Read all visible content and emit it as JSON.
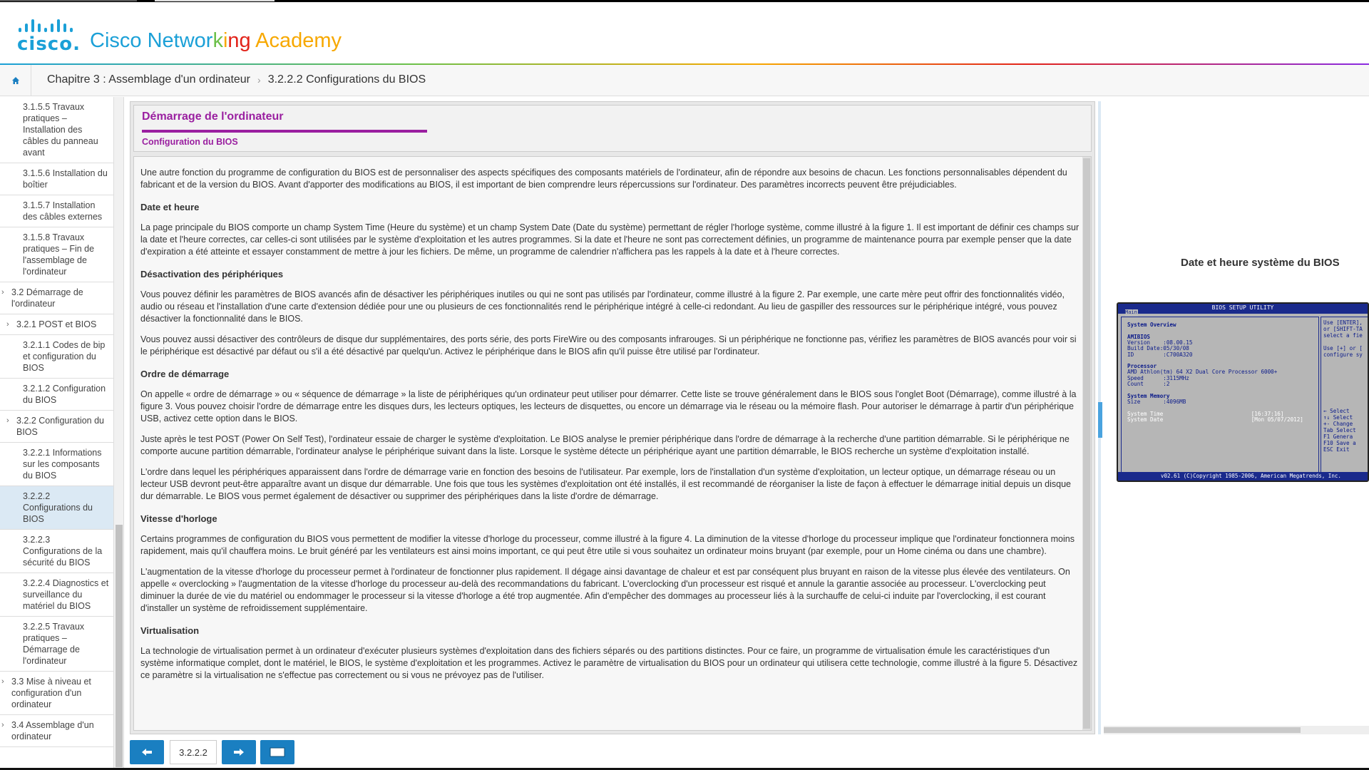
{
  "header": {
    "logo_word": "cisco",
    "brand_parts": [
      {
        "text": "Cisco ",
        "color": "#1ba0d7"
      },
      {
        "text": "Networ",
        "color": "#1ba0d7"
      },
      {
        "text": "k",
        "color": "#6cc04a"
      },
      {
        "text": "i",
        "color": "#f7a800"
      },
      {
        "text": "ng ",
        "color": "#e2231a"
      },
      {
        "text": "Academy",
        "color": "#f7a800"
      }
    ]
  },
  "breadcrumb": {
    "chapter": "Chapitre 3 : Assemblage d'un ordinateur",
    "section": "3.2.2.2 Configurations du BIOS"
  },
  "sidebar": [
    {
      "label": "3.1.5.5 Travaux pratiques – Installation des câbles du panneau avant",
      "level": 3
    },
    {
      "label": "3.1.5.6 Installation du boîtier",
      "level": 3
    },
    {
      "label": "3.1.5.7 Installation des câbles externes",
      "level": 3
    },
    {
      "label": "3.1.5.8 Travaux pratiques – Fin de l'assemblage de l'ordinateur",
      "level": 3
    },
    {
      "label": "3.2 Démarrage de l'ordinateur",
      "level": 1
    },
    {
      "label": "3.2.1 POST et BIOS",
      "level": 2
    },
    {
      "label": "3.2.1.1 Codes de bip et configuration du BIOS",
      "level": 3
    },
    {
      "label": "3.2.1.2 Configuration du BIOS",
      "level": 3
    },
    {
      "label": "3.2.2 Configuration du BIOS",
      "level": 2
    },
    {
      "label": "3.2.2.1 Informations sur les composants du BIOS",
      "level": 3
    },
    {
      "label": "3.2.2.2 Configurations du BIOS",
      "level": 3,
      "active": true
    },
    {
      "label": "3.2.2.3 Configurations de la sécurité du BIOS",
      "level": 3
    },
    {
      "label": "3.2.2.4 Diagnostics et surveillance du matériel du BIOS",
      "level": 3
    },
    {
      "label": "3.2.2.5 Travaux pratiques – Démarrage de l'ordinateur",
      "level": 3
    },
    {
      "label": "3.3 Mise à niveau et configuration d'un ordinateur",
      "level": 1
    },
    {
      "label": "3.4 Assemblage d'un ordinateur",
      "level": 1
    }
  ],
  "content": {
    "title": "Démarrage de l'ordinateur",
    "subtitle": "Configuration du BIOS",
    "blocks": [
      {
        "type": "p",
        "text": "Une autre fonction du programme de configuration du BIOS est de personnaliser des aspects spécifiques des composants matériels de l'ordinateur, afin de répondre aux besoins de chacun. Les fonctions personnalisables dépendent du fabricant et de la version du BIOS. Avant d'apporter des modifications au BIOS, il est important de bien comprendre leurs répercussions sur l'ordinateur. Des paramètres incorrects peuvent être préjudiciables."
      },
      {
        "type": "h",
        "text": "Date et heure"
      },
      {
        "type": "p",
        "text": "La page principale du BIOS comporte un champ System Time (Heure du système) et un champ System Date (Date du système) permettant de régler l'horloge système, comme illustré à la figure 1. Il est important de définir ces champs sur la date et l'heure correctes, car celles-ci sont utilisées par le système d'exploitation et les autres programmes. Si la date et l'heure ne sont pas correctement définies, un programme de maintenance pourra par exemple penser que la date d'expiration a été atteinte et essayer constamment de mettre à jour les fichiers. De même, un programme de calendrier n'affichera pas les rappels à la date et à l'heure correctes."
      },
      {
        "type": "h",
        "text": "Désactivation des périphériques"
      },
      {
        "type": "p",
        "text": "Vous pouvez définir les paramètres de BIOS avancés afin de désactiver les périphériques inutiles ou qui ne sont pas utilisés par l'ordinateur, comme illustré à la figure 2. Par exemple, une carte mère peut offrir des fonctionnalités vidéo, audio ou réseau et l'installation d'une carte d'extension dédiée pour une ou plusieurs de ces fonctionnalités rend le périphérique intégré à celle-ci redondant. Au lieu de gaspiller des ressources sur le périphérique intégré, vous pouvez désactiver la fonctionnalité dans le BIOS."
      },
      {
        "type": "p",
        "text": "Vous pouvez aussi désactiver des contrôleurs de disque dur supplémentaires, des ports série, des ports FireWire ou des composants infrarouges. Si un périphérique ne fonctionne pas, vérifiez les paramètres de BIOS avancés pour voir si le périphérique est désactivé par défaut ou s'il a été désactivé par quelqu'un. Activez le périphérique dans le BIOS afin qu'il puisse être utilisé par l'ordinateur."
      },
      {
        "type": "h",
        "text": "Ordre de démarrage"
      },
      {
        "type": "p",
        "text": "On appelle « ordre de démarrage » ou « séquence de démarrage » la liste de périphériques qu'un ordinateur peut utiliser pour démarrer. Cette liste se trouve généralement dans le BIOS sous l'onglet Boot (Démarrage), comme illustré à la figure 3. Vous pouvez choisir l'ordre de démarrage entre les disques durs, les lecteurs optiques, les lecteurs de disquettes, ou encore un démarrage via le réseau ou la mémoire flash. Pour autoriser le démarrage à partir d'un périphérique USB, activez cette option dans le BIOS."
      },
      {
        "type": "p",
        "text": "Juste après le test POST (Power On Self Test), l'ordinateur essaie de charger le système d'exploitation. Le BIOS analyse le premier périphérique dans l'ordre de démarrage à la recherche d'une partition démarrable. Si le périphérique ne comporte aucune partition démarrable, l'ordinateur analyse le périphérique suivant dans la liste. Lorsque le système détecte un périphérique ayant une partition démarrable, le BIOS recherche un système d'exploitation installé."
      },
      {
        "type": "p",
        "text": "L'ordre dans lequel les périphériques apparaissent dans l'ordre de démarrage varie en fonction des besoins de l'utilisateur. Par exemple, lors de l'installation d'un système d'exploitation, un lecteur optique, un démarrage réseau ou un lecteur USB devront peut-être apparaître avant un disque dur démarrable. Une fois que tous les systèmes d'exploitation ont été installés, il est recommandé de réorganiser la liste de façon à effectuer le démarrage initial depuis un disque dur démarrable. Le BIOS vous permet également de désactiver ou supprimer des périphériques dans la liste d'ordre de démarrage."
      },
      {
        "type": "h",
        "text": "Vitesse d'horloge"
      },
      {
        "type": "p",
        "text": "Certains programmes de configuration du BIOS vous permettent de modifier la vitesse d'horloge du processeur, comme illustré à la figure 4. La diminution de la vitesse d'horloge du processeur implique que l'ordinateur fonctionnera moins rapidement, mais qu'il chauffera moins. Le bruit généré par les ventilateurs est ainsi moins important, ce qui peut être utile si vous souhaitez un ordinateur moins bruyant (par exemple, pour un Home cinéma ou dans une chambre)."
      },
      {
        "type": "p",
        "text": "L'augmentation de la vitesse d'horloge du processeur permet à l'ordinateur de fonctionner plus rapidement. Il dégage ainsi davantage de chaleur et est par conséquent plus bruyant en raison de la vitesse plus élevée des ventilateurs. On appelle « overclocking » l'augmentation de la vitesse d'horloge du processeur au-delà des recommandations du fabricant. L'overclocking d'un processeur est risqué et annule la garantie associée au processeur. L'overclocking peut diminuer la durée de vie du matériel ou endommager le processeur si la vitesse d'horloge a été trop augmentée. Afin d'empêcher des dommages au processeur liés à la surchauffe de celui-ci induite par l'overclocking, il est courant d'installer un système de refroidissement supplémentaire."
      },
      {
        "type": "h",
        "text": "Virtualisation"
      },
      {
        "type": "p",
        "text": "La technologie de virtualisation permet à un ordinateur d'exécuter plusieurs systèmes d'exploitation dans des fichiers séparés ou des partitions distinctes. Pour ce faire, un programme de virtualisation émule les caractéristiques d'un système informatique complet, dont le matériel, le BIOS, le système d'exploitation et les programmes. Activez le paramètre de virtualisation du BIOS pour un ordinateur qui utilisera cette technologie, comme illustré à la figure 5. Désactivez ce paramètre si la virtualisation ne s'effectue pas correctement ou si vous ne prévoyez pas de l'utiliser."
      }
    ]
  },
  "nav": {
    "page": "3.2.2.2"
  },
  "figure": {
    "title": "Date et heure système du BIOS",
    "bios_header": "BIOS SETUP UTILITY",
    "bios_tab": "Main",
    "lines": [
      {
        "text": "System Overview",
        "bold": true
      },
      {
        "text": ""
      },
      {
        "text": "AMIBIOS",
        "bold": true
      },
      {
        "text": "Version    :08.00.15"
      },
      {
        "text": "Build Date:05/30/08"
      },
      {
        "text": "ID         :C700A320"
      },
      {
        "text": ""
      },
      {
        "text": "Processor",
        "bold": true
      },
      {
        "text": "AMD Athlon(tm) 64 X2 Dual Core Processor 6000+"
      },
      {
        "text": "Speed      :3115MHz"
      },
      {
        "text": "Count      :2"
      },
      {
        "text": ""
      },
      {
        "text": "System Memory",
        "bold": true
      },
      {
        "text": "Size       :4096MB"
      },
      {
        "text": ""
      },
      {
        "text": "System Time                           [16:37:16]",
        "hi": true
      },
      {
        "text": "System Date                           [Mon 05/07/2012]",
        "hi": true
      }
    ],
    "help": [
      "Use [ENTER],",
      "or [SHIFT-TA",
      "select a fie",
      "",
      "Use [+] or [",
      "configure sy"
    ],
    "keys": [
      "←   Select",
      "↑↓  Select",
      "+-  Change",
      "Tab  Select",
      "F1   Genera",
      "F10  Save a",
      "ESC  Exit"
    ],
    "footer": "v02.61 (C)Copyright 1985-2006, American Megatrends, Inc."
  }
}
